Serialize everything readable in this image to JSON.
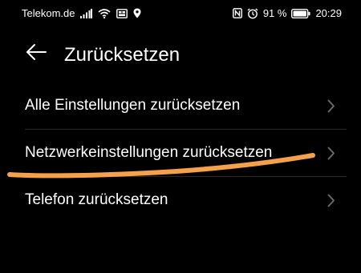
{
  "status_bar": {
    "carrier": "Telekom.de",
    "battery_percent": "91 %",
    "time": "20:29",
    "icons": [
      "signal-icon",
      "wifi-icon",
      "screen-cast-icon",
      "location-icon",
      "nfc-icon",
      "alarm-icon",
      "battery-icon"
    ]
  },
  "header": {
    "back_icon": "arrow-left-icon",
    "title": "Zurücksetzen"
  },
  "items": [
    {
      "label": "Alle Einstellungen zurücksetzen",
      "icon": "chevron-right-icon"
    },
    {
      "label": "Netzwerkeinstellungen zurücksetzen",
      "icon": "chevron-right-icon"
    },
    {
      "label": "Telefon zurücksetzen",
      "icon": "chevron-right-icon"
    }
  ],
  "annotation": {
    "type": "hand-drawn underline",
    "color": "#f5a04a",
    "target_item": "Netzwerkeinstellungen zurücksetzen"
  },
  "colors": {
    "background": "#000000",
    "text": "#ffffff",
    "chevron": "#6e6e6e",
    "divider": "#2a2a2a"
  }
}
